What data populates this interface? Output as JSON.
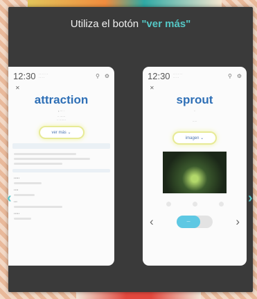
{
  "heading": {
    "prefix": "Utiliza el botón ",
    "highlight": "\"ver más\""
  },
  "left_card": {
    "time": "12:30",
    "word": "attraction",
    "pill_label": "ver más"
  },
  "right_card": {
    "time": "12:30",
    "word": "sprout",
    "pill_label": "imagen"
  },
  "colors": {
    "accent": "#55c7c5",
    "word": "#2e6fb6",
    "toggle": "#5ec8e3",
    "highlight_glow": "#e7ea96"
  },
  "icons": [
    "search-icon",
    "settings-icon",
    "close-icon",
    "chevron-left-icon",
    "chevron-right-icon"
  ]
}
